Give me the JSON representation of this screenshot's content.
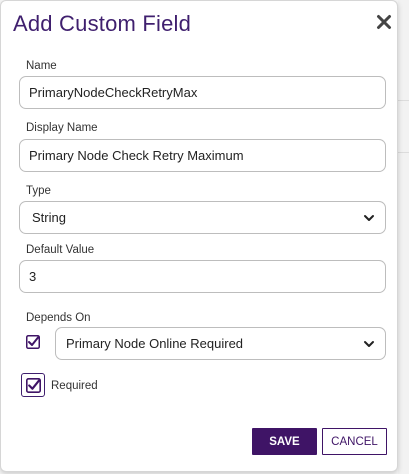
{
  "dialog": {
    "title": "Add Custom Field",
    "close_icon": "close-icon"
  },
  "fields": {
    "name": {
      "label": "Name",
      "value": "PrimaryNodeCheckRetryMax"
    },
    "display_name": {
      "label": "Display Name",
      "value": "Primary Node Check Retry Maximum"
    },
    "type": {
      "label": "Type",
      "selected": "String"
    },
    "default_value": {
      "label": "Default Value",
      "value": "3"
    },
    "depends_on": {
      "label": "Depends On",
      "checked": true,
      "selected": "Primary Node Online Required"
    },
    "required": {
      "label": "Required",
      "checked": true
    }
  },
  "buttons": {
    "save_label": "SAVE",
    "cancel_label": "CANCEL"
  },
  "colors": {
    "accent": "#3f1466",
    "title": "#3f1f6e",
    "border": "#bdbdbd"
  },
  "icons": {
    "chevron": "chevron-down-icon",
    "check": "checkmark-icon"
  }
}
